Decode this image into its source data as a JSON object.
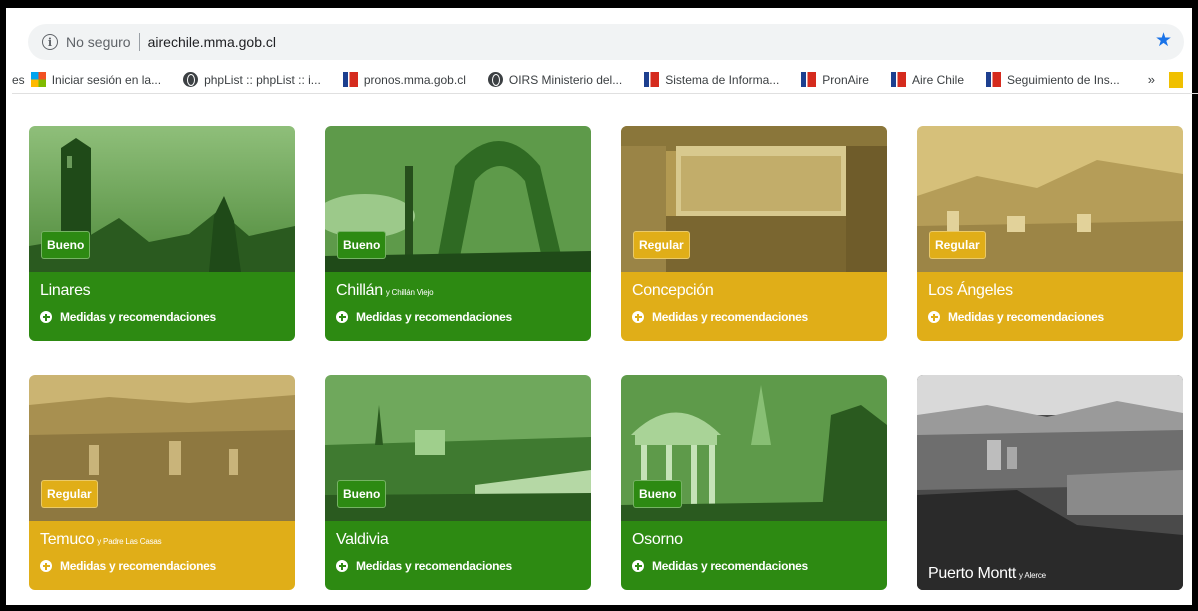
{
  "browser": {
    "security_label": "No seguro",
    "url": "airechile.mma.gob.cl",
    "bookmarks_cut": "es",
    "bookmarks": [
      {
        "label": "Iniciar sesión en la...",
        "icon": "microsoft-icon"
      },
      {
        "label": "phpList :: phpList :: i...",
        "icon": "globe-icon"
      },
      {
        "label": "pronos.mma.gob.cl",
        "icon": "gob-cl-icon"
      },
      {
        "label": "OIRS Ministerio del...",
        "icon": "globe-icon"
      },
      {
        "label": "Sistema de Informa...",
        "icon": "gob-cl-icon"
      },
      {
        "label": "PronAire",
        "icon": "gob-cl-icon"
      },
      {
        "label": "Aire Chile",
        "icon": "gob-cl-icon"
      },
      {
        "label": "Seguimiento de Ins...",
        "icon": "gob-cl-icon"
      }
    ],
    "more_label": "»"
  },
  "colors": {
    "bueno": "#2d8a12",
    "regular": "#e0ae18"
  },
  "cards": [
    {
      "city": "Linares",
      "sub": "",
      "status": "Bueno",
      "link": "Medidas y recomendaciones"
    },
    {
      "city": "Chillán",
      "sub": "y Chillán Viejo",
      "status": "Bueno",
      "link": "Medidas y recomendaciones"
    },
    {
      "city": "Concepción",
      "sub": "",
      "status": "Regular",
      "link": "Medidas y recomendaciones"
    },
    {
      "city": "Los Ángeles",
      "sub": "",
      "status": "Regular",
      "link": "Medidas y recomendaciones"
    },
    {
      "city": "Temuco",
      "sub": "y Padre Las Casas",
      "status": "Regular",
      "link": "Medidas y recomendaciones"
    },
    {
      "city": "Valdivia",
      "sub": "",
      "status": "Bueno",
      "link": "Medidas y recomendaciones"
    },
    {
      "city": "Osorno",
      "sub": "",
      "status": "Bueno",
      "link": "Medidas y recomendaciones"
    },
    {
      "city": "Puerto Montt",
      "sub": "y Alerce",
      "status": "",
      "link": ""
    }
  ]
}
